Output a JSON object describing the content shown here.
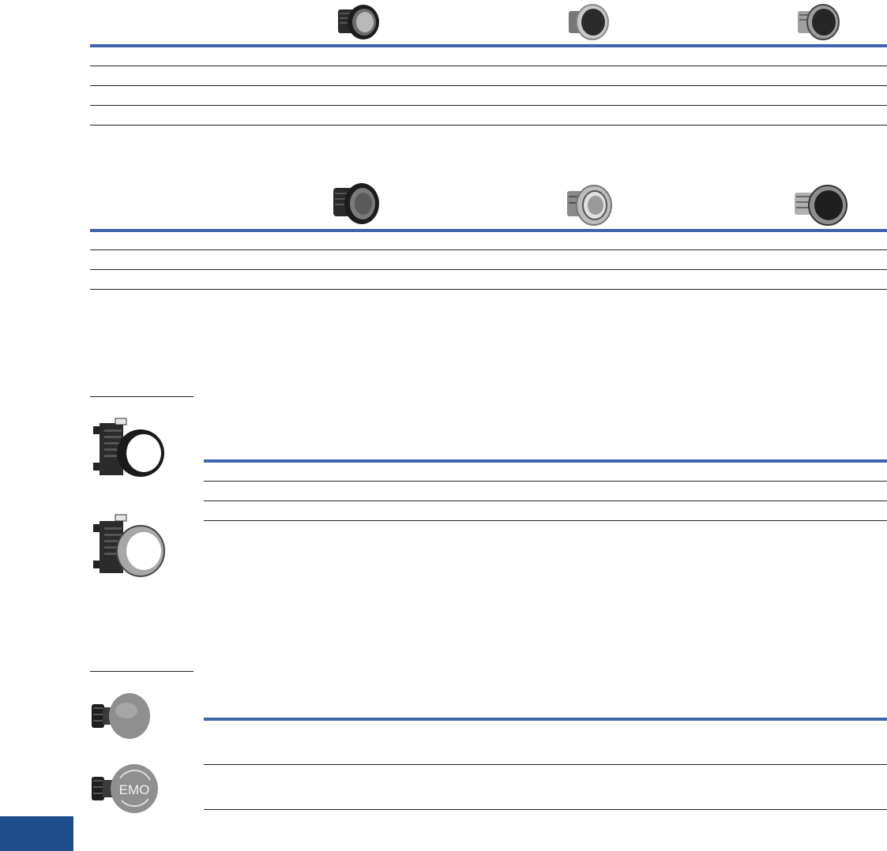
{
  "page": {
    "section_tab_color": "#1f4e8c",
    "rule_color": "#3f64ad",
    "line_color": "#231f20"
  },
  "table1": {
    "product_images": [
      "plastic-bezel-pushbutton-image",
      "chrome-bezel-pushbutton-image",
      "metal-bezel-pushbutton-image"
    ],
    "row_count": 4
  },
  "table2": {
    "product_images": [
      "plastic-bezel-illuminated-pushbutton-image",
      "chrome-ring-illuminated-pushbutton-image",
      "metal-illuminated-pushbutton-image"
    ],
    "row_count": 3
  },
  "section3": {
    "product_images": [
      "flush-pushbutton-with-latch-black-bezel-image",
      "flush-pushbutton-with-latch-chrome-bezel-image"
    ],
    "row_count": 3
  },
  "section4": {
    "product_images": [
      "mushroom-head-pushbutton-image",
      "emo-mushroom-head-pushbutton-image"
    ],
    "emo_label": "EMO",
    "row_count": 2
  }
}
